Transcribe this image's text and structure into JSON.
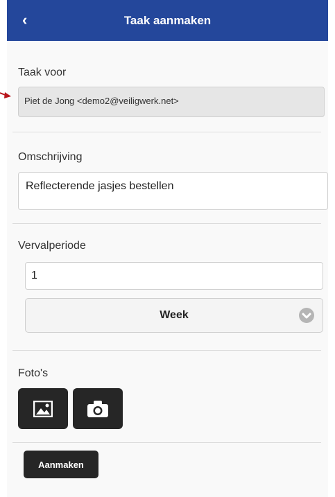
{
  "header": {
    "back_glyph": "‹",
    "title": "Taak aanmaken",
    "back_icon": "chevron-left-icon",
    "background": "#24479b"
  },
  "form": {
    "assignee": {
      "label": "Taak voor",
      "value": "Piet de Jong <demo2@veiligwerk.net>"
    },
    "description": {
      "label": "Omschrijving",
      "value": "Reflecterende jasjes bestellen"
    },
    "expiry": {
      "label": "Vervalperiode",
      "amount": "1",
      "unit": "Week",
      "unit_icon": "chevron-down-circle-icon"
    },
    "photos": {
      "label": "Foto's",
      "gallery_icon": "image-icon",
      "camera_icon": "camera-icon"
    },
    "submit_label": "Aanmaken"
  },
  "annotation": {
    "icon": "arrow-pointer-icon",
    "color": "#b8151b"
  }
}
